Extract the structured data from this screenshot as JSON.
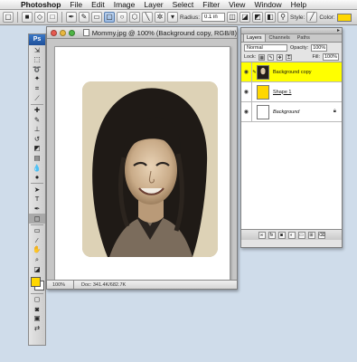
{
  "menubar": {
    "app": "Photoshop",
    "items": [
      "File",
      "Edit",
      "Image",
      "Layer",
      "Select",
      "Filter",
      "View",
      "Window",
      "Help"
    ]
  },
  "options": {
    "radius_label": "Radius:",
    "radius_value": "0.1 in",
    "style_label": "Style:",
    "color_label": "Color:",
    "color": "#ffd700"
  },
  "toolbox": {
    "logo": "Ps",
    "foreground_color": "#ffd700",
    "background_color": "#ffffff"
  },
  "document": {
    "title": "Mommy.jpg @ 100% (Background copy, RGB/8)",
    "zoom": "100%",
    "doc_size": "Doc: 341.4K/682.7K"
  },
  "layers": {
    "tabs": [
      "Layers",
      "Channels",
      "Paths"
    ],
    "blend_mode": "Normal",
    "opacity_label": "Opacity:",
    "opacity": "100%",
    "lock_label": "Lock:",
    "fill_label": "Fill:",
    "fill": "100%",
    "items": [
      {
        "name": "Background copy",
        "visible": true,
        "selected": true
      },
      {
        "name": "Shape 1",
        "visible": true,
        "selected": false
      },
      {
        "name": "Background",
        "visible": true,
        "selected": false,
        "locked": true
      }
    ],
    "footer_fx": "fx"
  }
}
